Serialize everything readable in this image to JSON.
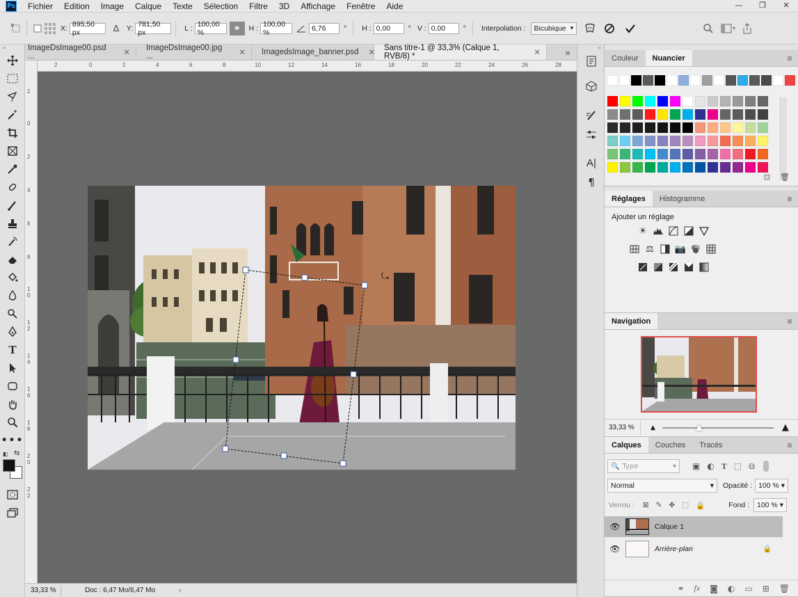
{
  "app": {
    "logo": "Ps"
  },
  "menu": [
    "Fichier",
    "Edition",
    "Image",
    "Calque",
    "Texte",
    "Sélection",
    "Filtre",
    "3D",
    "Affichage",
    "Fenêtre",
    "Aide"
  ],
  "window_controls": {
    "minimize": "—",
    "restore": "❐",
    "close": "✕"
  },
  "options": {
    "x_label": "X:",
    "x_value": "895,50 px",
    "y_label": "Y:",
    "y_value": "781,50 px",
    "w_label": "L :",
    "w_value": "100,00 %",
    "h_label": "H :",
    "h_value": "100,00 %",
    "angle_value": "6,76",
    "angle_unit": "°",
    "hskew_label": "H :",
    "hskew_value": "0,00",
    "hskew_unit": "°",
    "vskew_label": "V :",
    "vskew_value": "0,00",
    "vskew_unit": "°",
    "interp_label": "Interpolation :",
    "interp_value": "Bicubique"
  },
  "tabs": [
    {
      "label": "ImageDsImage00.psd ...",
      "close": "✕"
    },
    {
      "label": "ImageDsImage00.jpg ...",
      "close": "✕"
    },
    {
      "label": "ImagedsImage_banner.psd",
      "close": "✕"
    },
    {
      "label": "Sans titre-1 @ 33,3% (Calque 1, RVB/8) *",
      "close": "✕"
    }
  ],
  "tabs_overflow": "»",
  "ruler_h_ticks": [
    "2",
    "0",
    "2",
    "4",
    "6",
    "8",
    "10",
    "12",
    "14",
    "16",
    "18",
    "20",
    "22",
    "24",
    "26",
    "28"
  ],
  "ruler_v_ticks": [
    "2",
    "0",
    "2",
    "4",
    "6",
    "8",
    "1 0",
    "1 2",
    "1 4",
    "1 6",
    "1 8",
    "2 0",
    "2 2"
  ],
  "status": {
    "zoom": "33,33 %",
    "doc": "Doc : 6,47 Mo/6,47 Mo",
    "arrow": "›"
  },
  "swatches_panel": {
    "tabs": [
      "Couleur",
      "Nuancier"
    ],
    "active": "Nuancier"
  },
  "adjust_panel": {
    "tabs": [
      "Réglages",
      "Histogramme"
    ],
    "active": "Réglages",
    "add_label": "Ajouter un réglage"
  },
  "nav_panel": {
    "tabs": [
      "Navigation"
    ],
    "zoom": "33,33 %"
  },
  "layers_panel": {
    "tabs": [
      "Calques",
      "Couches",
      "Tracés"
    ],
    "active": "Calques",
    "filter_placeholder": "Type",
    "blend_mode": "Normal",
    "opacity_label": "Opacité :",
    "opacity_value": "100 %",
    "lock_label": "Verrou :",
    "fill_label": "Fond :",
    "fill_value": "100 %",
    "layers": [
      {
        "name": "Calque 1",
        "selected": true
      },
      {
        "name": "Arrière-plan",
        "selected": false
      }
    ]
  },
  "colors": {
    "accent": "#31a8ff",
    "nav_frame": "#e04c4c"
  }
}
